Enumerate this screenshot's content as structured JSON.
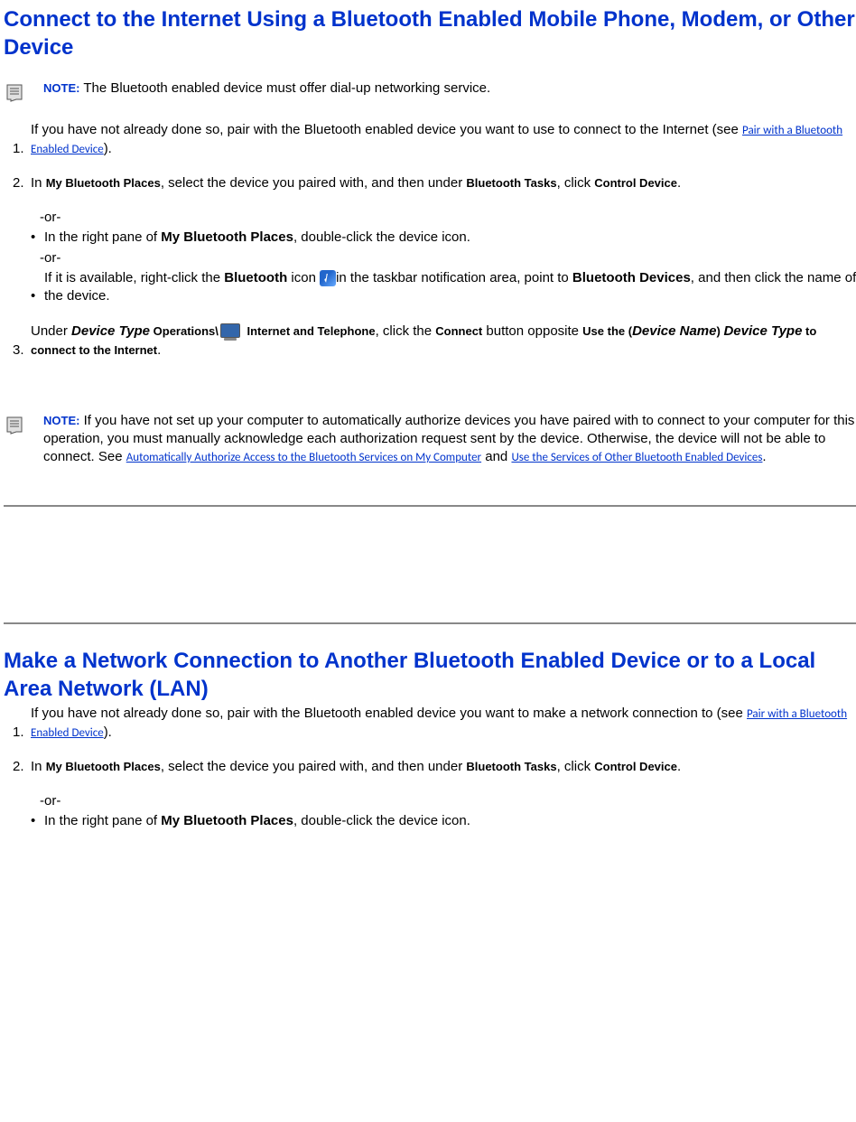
{
  "section1": {
    "title": "Connect to the Internet Using a Bluetooth Enabled Mobile Phone, Modem, or Other Device",
    "note1_label": "NOTE:",
    "note1_text": " The Bluetooth enabled device must offer dial-up networking service.",
    "step1_num": "1.",
    "step1_a": "If you have not already done so, pair with the Bluetooth enabled device you want to use to connect to the Internet (see ",
    "step1_link": "Pair with a Bluetooth Enabled Device",
    "step1_b": ").",
    "step2_num": "2.",
    "step2_a": "In ",
    "step2_b1": "My Bluetooth Places",
    "step2_c": ", select the device you paired with, and then under ",
    "step2_b2": "Bluetooth Tasks",
    "step2_d": ", click ",
    "step2_b3": "Control Device",
    "step2_e": ".",
    "or1": "-or-",
    "sub_bullet": "•",
    "sub1_a": "In the right pane of ",
    "sub1_b": "My Bluetooth Places",
    "sub1_c": ", double-click the device icon.",
    "or2": "-or-",
    "sub2_a": "If it is available, right-click the ",
    "sub2_b": "Bluetooth",
    "sub2_c": " icon ",
    "sub2_d": "in the taskbar notification area, point to ",
    "sub2_e": "Bluetooth Devices",
    "sub2_f": ", and then click the name of the device.",
    "step3_num": "3.",
    "step3_a": "Under ",
    "step3_b1": "Device Type",
    "step3_b2": " Operations\\",
    "step3_b3": " Internet and Telephone",
    "step3_c": ", click the ",
    "step3_b4": "Connect",
    "step3_d": " button opposite ",
    "step3_b5": "Use the (",
    "step3_b6": "Device Name",
    "step3_b7": ") ",
    "step3_b8": "Device Type",
    "step3_b9": " to connect to the Internet",
    "step3_e": ".",
    "note2_label": "NOTE:",
    "note2_a": " If you have not set up your computer to automatically authorize devices you have paired with to connect to your computer for this operation, you must manually acknowledge each authorization request sent by the device. Otherwise, the device will not be able to connect. See ",
    "note2_link1": "Automatically Authorize Access to the Bluetooth Services on My Computer",
    "note2_b": " and ",
    "note2_link2": "Use the Services of Other Bluetooth Enabled Devices",
    "note2_c": "."
  },
  "section2": {
    "title": "Make a Network Connection to Another Bluetooth Enabled Device or to a Local Area Network (LAN)",
    "step1_num": "1.",
    "step1_a": "If you have not already done so, pair with the Bluetooth enabled device you want to make a network connection to (see ",
    "step1_link": "Pair with a Bluetooth Enabled Device",
    "step1_b": ").",
    "step2_num": "2.",
    "step2_a": "In ",
    "step2_b1": "My Bluetooth Places",
    "step2_c": ", select the device you paired with, and then under ",
    "step2_b2": "Bluetooth Tasks",
    "step2_d": ", click ",
    "step2_b3": "Control Device",
    "step2_e": ".",
    "or1": "-or-",
    "sub_bullet": "•",
    "sub1_a": "In the right pane of ",
    "sub1_b": "My Bluetooth Places",
    "sub1_c": ", double-click the device icon."
  }
}
